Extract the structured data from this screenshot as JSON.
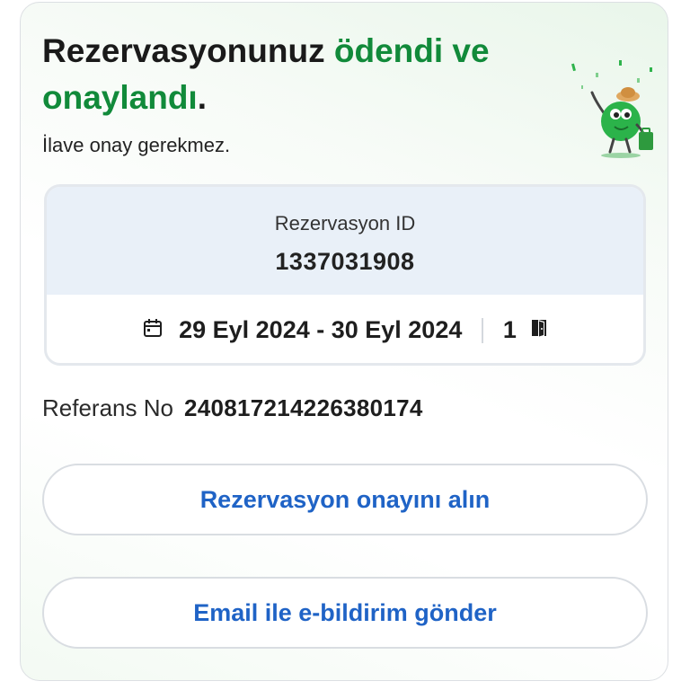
{
  "header": {
    "title_part1": "Rezervasyonunuz ",
    "title_part2": "ödendi ve onaylandı",
    "title_part3": ".",
    "subtitle": "İlave onay gerekmez."
  },
  "booking": {
    "reservation_label": "Rezervasyon ID",
    "reservation_id": "1337031908",
    "dates": "29 Eyl 2024 - 30 Eyl 2024",
    "room_count": "1",
    "icons": [
      "calendar-icon",
      "door-icon"
    ]
  },
  "reference": {
    "label": "Referans No",
    "value": "240817214226380174"
  },
  "actions": {
    "get_confirmation_label": "Rezervasyon onayını alın",
    "send_email_label": "Email ile e-bildirim gönder"
  },
  "colors": {
    "accent_green": "#118a3a",
    "link_blue": "#1f63c6",
    "box_header_bg": "#e9f0f8"
  }
}
